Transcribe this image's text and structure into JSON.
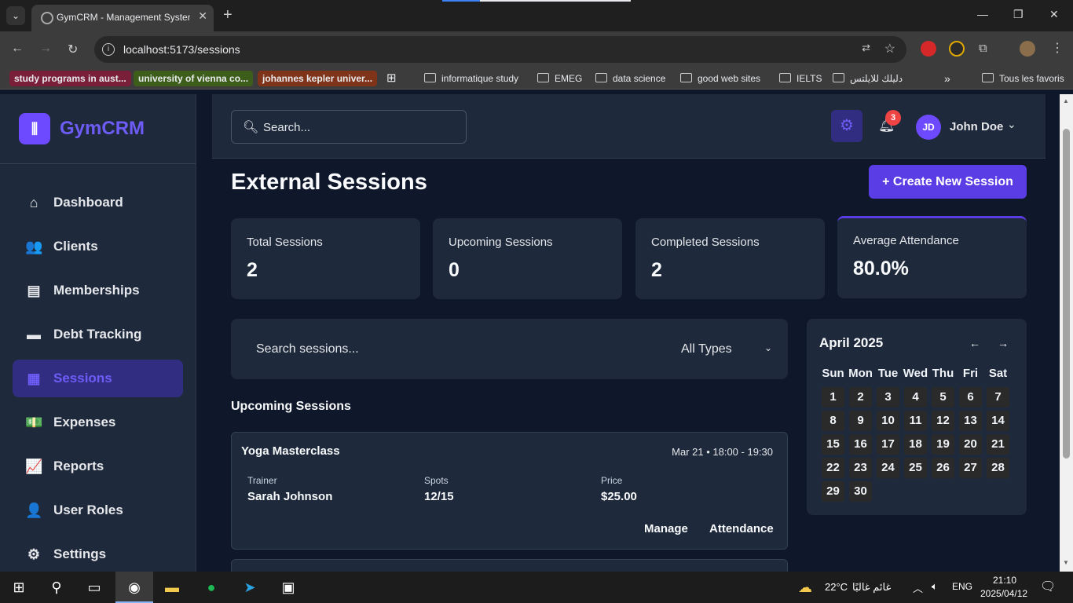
{
  "browser": {
    "tab_title": "GymCRM - Management System",
    "url": "localhost:5173/sessions",
    "bookmarks_pills": [
      {
        "label": "study programs in aust...",
        "bg": "#8a1f3b"
      },
      {
        "label": "university of vienna co...",
        "bg": "#3d5e1a"
      },
      {
        "label": "johannes kepler univer...",
        "bg": "#8a3a1f"
      }
    ],
    "bookmarks_folders": [
      "informatique study",
      "EMEG",
      "data science",
      "good web sites",
      "IELTS",
      "دليلك للايلتس"
    ],
    "all_bookmarks": "Tous les favoris"
  },
  "app": {
    "brand": "GymCRM",
    "search_placeholder": "Search...",
    "notification_count": "3",
    "user_initials": "JD",
    "user_name": "John Doe",
    "nav": [
      {
        "label": "Dashboard",
        "icon": "home-icon"
      },
      {
        "label": "Clients",
        "icon": "users-icon"
      },
      {
        "label": "Memberships",
        "icon": "id-card-icon"
      },
      {
        "label": "Debt Tracking",
        "icon": "credit-card-icon"
      },
      {
        "label": "Sessions",
        "icon": "calendar-icon",
        "active": true
      },
      {
        "label": "Expenses",
        "icon": "money-icon"
      },
      {
        "label": "Reports",
        "icon": "chart-line-icon"
      },
      {
        "label": "User Roles",
        "icon": "user-lock-icon"
      },
      {
        "label": "Settings",
        "icon": "gear-icon"
      }
    ]
  },
  "page": {
    "title": "External Sessions",
    "create_button": "+ Create New Session",
    "stats": [
      {
        "label": "Total Sessions",
        "value": "2"
      },
      {
        "label": "Upcoming Sessions",
        "value": "0"
      },
      {
        "label": "Completed Sessions",
        "value": "2"
      },
      {
        "label": "Average Attendance",
        "value": "80.0%"
      }
    ],
    "session_search_placeholder": "Search sessions...",
    "type_filter": "All Types",
    "upcoming_heading": "Upcoming Sessions",
    "sessions": [
      {
        "name": "Yoga Masterclass",
        "when": "Mar 21 • 18:00 - 19:30",
        "trainer_label": "Trainer",
        "trainer": "Sarah Johnson",
        "spots_label": "Spots",
        "spots": "12/15",
        "price_label": "Price",
        "price": "$25.00",
        "manage": "Manage",
        "attendance": "Attendance"
      }
    ],
    "calendar": {
      "month": "April 2025",
      "weekdays": [
        "Sun",
        "Mon",
        "Tue",
        "Wed",
        "Thu",
        "Fri",
        "Sat"
      ],
      "days": [
        "1",
        "2",
        "3",
        "4",
        "5",
        "6",
        "7",
        "8",
        "9",
        "10",
        "11",
        "12",
        "13",
        "14",
        "15",
        "16",
        "17",
        "18",
        "19",
        "20",
        "21",
        "22",
        "23",
        "24",
        "25",
        "26",
        "27",
        "28",
        "29",
        "30"
      ]
    }
  },
  "taskbar": {
    "weather": "22°C",
    "weather_text": "غائم غالبًا",
    "lang": "ENG",
    "time": "21:10",
    "date": "2025/04/12"
  },
  "colors": {
    "accent": "#6d4aff",
    "active_bg": "#312e81",
    "badge": "#ef4444"
  }
}
